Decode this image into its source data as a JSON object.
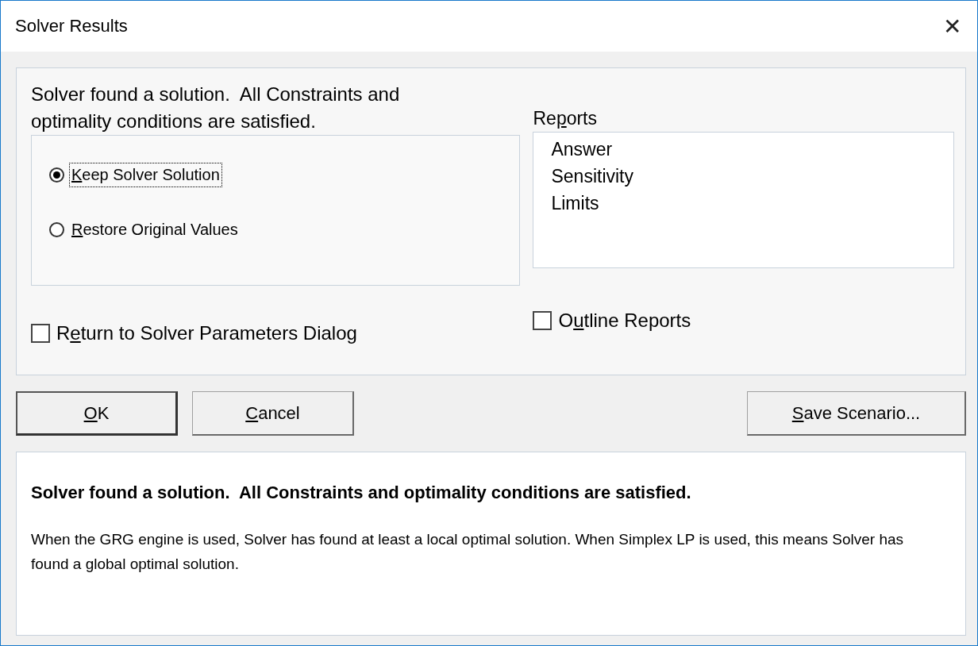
{
  "window": {
    "title": "Solver Results",
    "close_glyph": "✕"
  },
  "message": "Solver found a solution.  All Constraints and optimality conditions are satisfied.",
  "options": [
    {
      "label": {
        "key": "K",
        "post": "eep Solver Solution"
      },
      "selected": true,
      "focused": true
    },
    {
      "label": {
        "key": "R",
        "post": "estore Original Values"
      },
      "selected": false,
      "focused": false
    }
  ],
  "return_checkbox": {
    "label": {
      "pre": "R",
      "key": "e",
      "post": "turn to Solver Parameters Dialog"
    },
    "checked": false
  },
  "reports": {
    "label": {
      "pre": "Re",
      "key": "p",
      "post": "orts"
    },
    "items": [
      {
        "label": "Answer",
        "selected": false
      },
      {
        "label": "Sensitivity",
        "selected": false
      },
      {
        "label": "Limits",
        "selected": false
      }
    ]
  },
  "outline_checkbox": {
    "label": {
      "pre": "O",
      "key": "u",
      "post": "tline Reports"
    },
    "checked": false
  },
  "left_buttons": [
    {
      "label": {
        "key": "O",
        "post": "K"
      },
      "default": true
    },
    {
      "label": {
        "key": "C",
        "post": "ancel"
      },
      "default": false
    }
  ],
  "right_buttons": [
    {
      "label": {
        "key": "S",
        "post": "ave Scenario..."
      },
      "default": false
    }
  ],
  "details": {
    "heading": "Solver found a solution.  All Constraints and optimality conditions are satisfied.",
    "text": "When the GRG engine is used, Solver has found at least a local optimal solution. When Simplex LP is used, this means Solver has found a global optimal solution."
  }
}
